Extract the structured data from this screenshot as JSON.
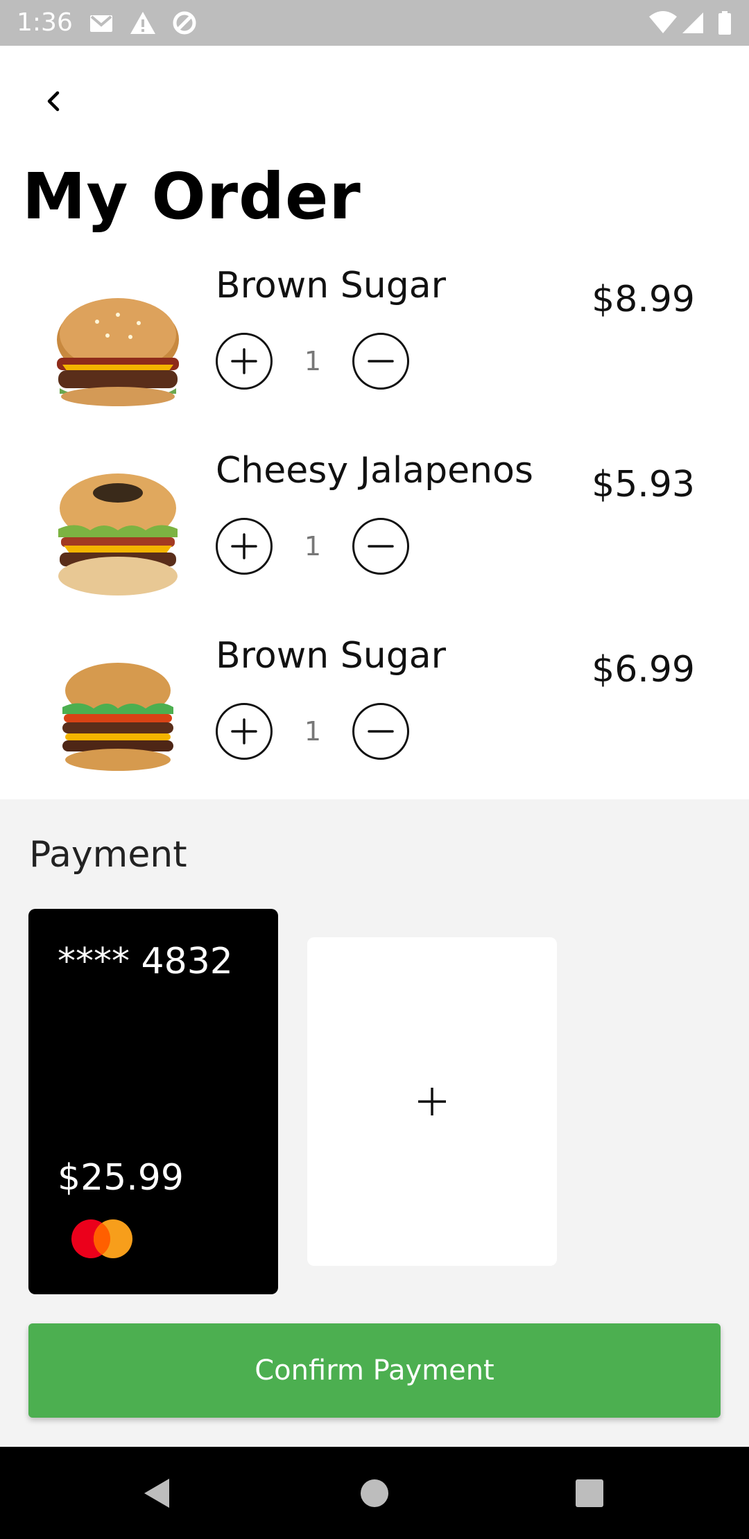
{
  "status_bar": {
    "time": "1:36",
    "icons": [
      "gmail-icon",
      "warning-icon",
      "data-saver-icon",
      "wifi-icon",
      "cell-signal-icon",
      "battery-icon"
    ]
  },
  "header": {
    "back_icon": "chevron-left-icon",
    "title": "My Order"
  },
  "order": {
    "items": [
      {
        "name": "Brown Sugar",
        "quantity": "1",
        "price": "$8.99",
        "image": "burger-image"
      },
      {
        "name": "Cheesy Jalapenos",
        "quantity": "1",
        "price": "$5.93",
        "image": "burger-image"
      },
      {
        "name": "Brown Sugar",
        "quantity": "1",
        "price": "$6.99",
        "image": "burger-image"
      }
    ],
    "increment_icon": "plus-circle-icon",
    "decrement_icon": "minus-circle-icon"
  },
  "payment": {
    "heading": "Payment",
    "card": {
      "number": "**** 4832",
      "amount": "$25.99",
      "brand_icon": "mastercard-icon"
    },
    "add_card_icon": "plus-icon",
    "confirm_label": "Confirm Payment"
  },
  "navigation": {
    "back_icon": "triangle-back-icon",
    "home_icon": "circle-home-icon",
    "recents_icon": "square-recents-icon"
  },
  "colors": {
    "status_bar": "#bdbdbd",
    "accent_green": "#4caf50",
    "card_black": "#000000",
    "payment_bg": "#f3f3f3",
    "mastercard_red": "#eb001b",
    "mastercard_orange": "#f79e1b"
  }
}
